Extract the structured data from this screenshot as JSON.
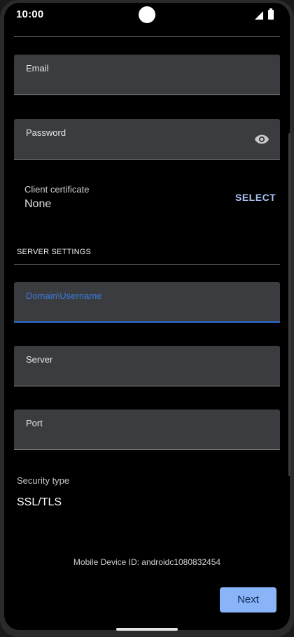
{
  "status_bar": {
    "time": "10:00",
    "icons": [
      "signal-icon",
      "battery-icon"
    ]
  },
  "form": {
    "email_label": "Email",
    "email_value": "",
    "password_label": "Password",
    "password_value": "",
    "password_toggle_icon": "eye-icon",
    "client_certificate": {
      "label": "Client certificate",
      "value": "None",
      "action": "SELECT"
    },
    "server_settings_header": "SERVER SETTINGS",
    "domain_username_label": "Domain\\Username",
    "domain_username_value": "",
    "server_label": "Server",
    "server_value": "",
    "port_label": "Port",
    "port_value": "",
    "security_type_label": "Security type",
    "security_type_value": "SSL/TLS"
  },
  "footer": {
    "device_id_text": "Mobile Device ID: androidc1080832454",
    "next_label": "Next"
  },
  "colors": {
    "background": "#000000",
    "field_background": "#3b3c40",
    "accent": "#3a78d9",
    "button": "#8ab4f8",
    "select_link": "#a8c4f5"
  }
}
